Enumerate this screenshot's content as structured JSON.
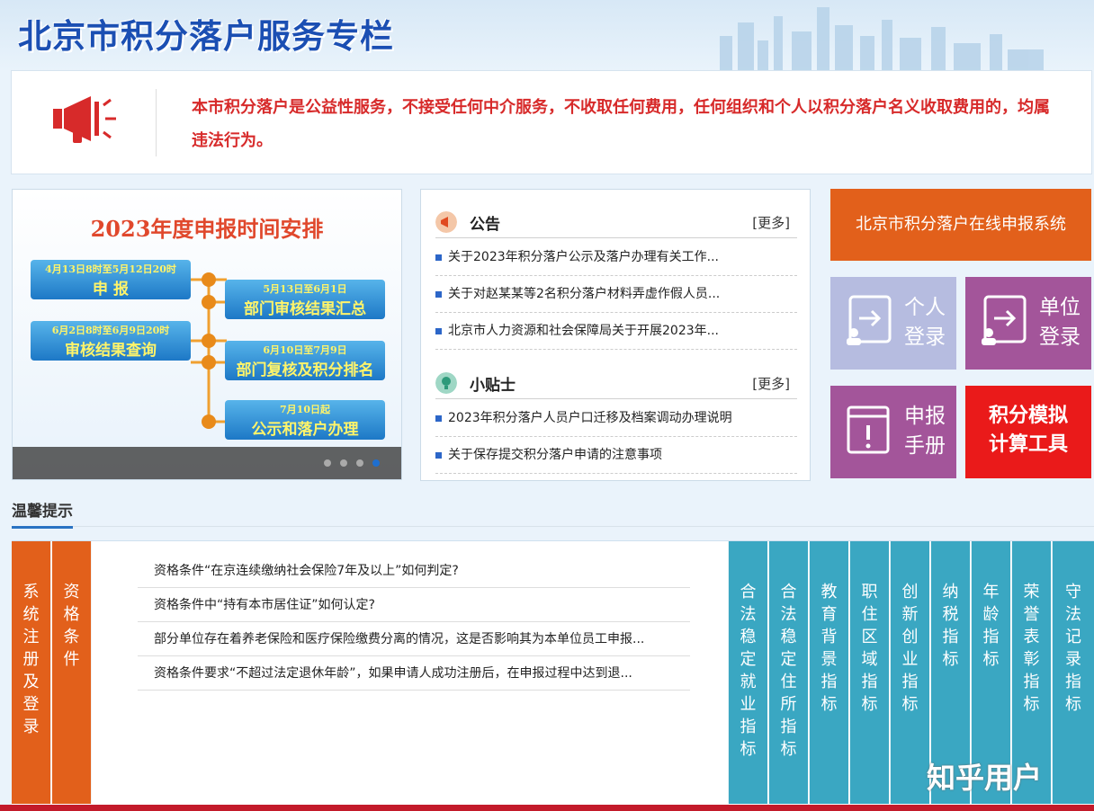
{
  "header": {
    "title": "北京市积分落户服务专栏"
  },
  "notice": {
    "text": "本市积分落户是公益性服务，不接受任何中介服务，不收取任何费用，任何组织和个人以积分落户名义收取费用的，均属违法行为。"
  },
  "banner": {
    "title": "2023年度申报时间安排",
    "steps": [
      {
        "time": "4月13日8时至5月12日20时",
        "label": "申 报"
      },
      {
        "time": "5月13日至6月1日",
        "label": "部门审核结果汇总"
      },
      {
        "time": "6月2日8时至6月9日20时",
        "label": "审核结果查询"
      },
      {
        "time": "6月10日至7月9日",
        "label": "部门复核及积分排名"
      },
      {
        "time": "7月10日起",
        "label": "公示和落户办理"
      }
    ],
    "active_slide": 4,
    "slide_count": 4
  },
  "announcements": {
    "title": "公告",
    "more": "[更多]",
    "items": [
      "关于2023年积分落户公示及落户办理有关工作...",
      "关于对赵某某等2名积分落户材料弄虚作假人员...",
      "北京市人力资源和社会保障局关于开展2023年..."
    ]
  },
  "tips_box": {
    "title": "小贴士",
    "more": "[更多]",
    "items": [
      "2023年积分落户人员户口迁移及档案调动办理说明",
      "关于保存提交积分落户申请的注意事项"
    ]
  },
  "tiles": {
    "online_system": "北京市积分落户在线申报系统",
    "personal_login": "个人登录",
    "unit_login": "单位登录",
    "manual": "申报手册",
    "calculator": "积分模拟计算工具"
  },
  "warm_tips": {
    "title": "温馨提示",
    "left_tabs": [
      "系统注册及登录",
      "资格条件"
    ],
    "questions": [
      "资格条件“在京连续缴纳社会保险7年及以上”如何判定?",
      "资格条件中“持有本市居住证”如何认定?",
      "部分单位存在着养老保险和医疗保险缴费分离的情况，这是否影响其为本单位员工申报...",
      "资格条件要求“不超过法定退休年龄”，如果申请人成功注册后，在申报过程中达到退..."
    ],
    "right_tabs": [
      "合法稳定就业指标",
      "合法稳定住所指标",
      "教育背景指标",
      "职住区域指标",
      "创新创业指标",
      "纳税指标",
      "年龄指标",
      "荣誉表彰指标",
      "守法记录指标"
    ]
  },
  "watermark": "知乎用户",
  "colors": {
    "orange": "#e2601b",
    "purple": "#a3559a",
    "lavender": "#b6bce0",
    "red": "#ea1a1a",
    "teal": "#3aa7c2",
    "notice_red": "#d72a2a",
    "title_blue": "#1b4fb3"
  }
}
